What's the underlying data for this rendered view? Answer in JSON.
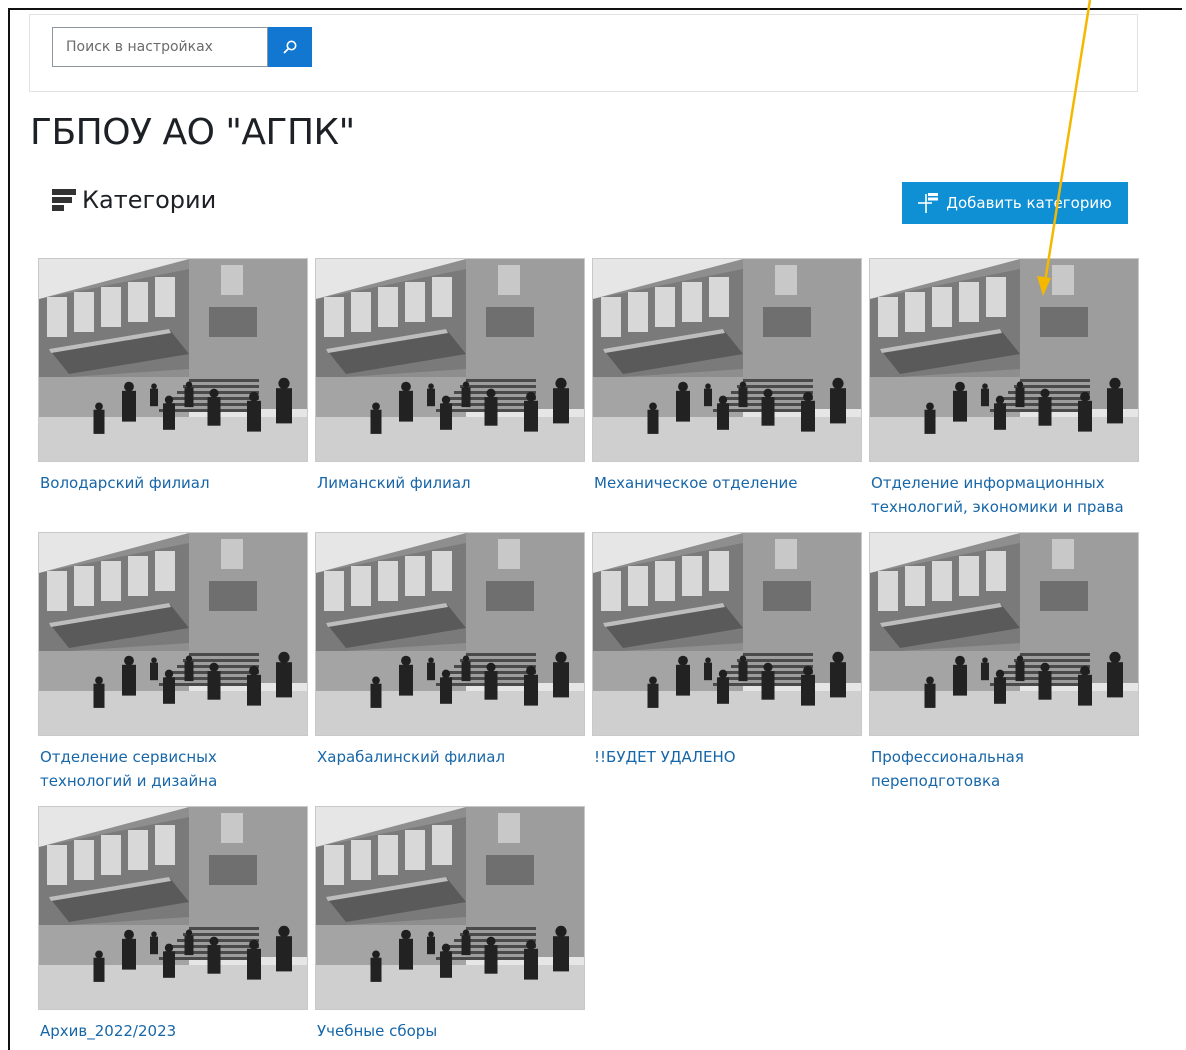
{
  "search": {
    "placeholder": "Поиск в настройках",
    "button_icon": "search-icon"
  },
  "page": {
    "title": "ГБПОУ АО \"АГПК\""
  },
  "section": {
    "heading": "Категории",
    "heading_icon": "categories-icon"
  },
  "toolbar": {
    "add_category_label": "Добавить категорию",
    "add_category_icon": "add-category-icon"
  },
  "categories": [
    {
      "name": "Володарский филиал"
    },
    {
      "name": "Лиманский филиал"
    },
    {
      "name": "Механическое отделение"
    },
    {
      "name": "Отделение информационных технологий, экономики и права"
    },
    {
      "name": "Отделение сервисных технологий и дизайна"
    },
    {
      "name": "Харабалинский филиал"
    },
    {
      "name": "!!БУДЕТ УДАЛЕНО"
    },
    {
      "name": "Профессиональная переподготовка"
    },
    {
      "name": "Архив_2022/2023"
    },
    {
      "name": "Учебные сборы"
    }
  ],
  "colors": {
    "accent": "#0f8fd4",
    "link": "#1766a8",
    "annotation_arrow": "#f5b800"
  }
}
